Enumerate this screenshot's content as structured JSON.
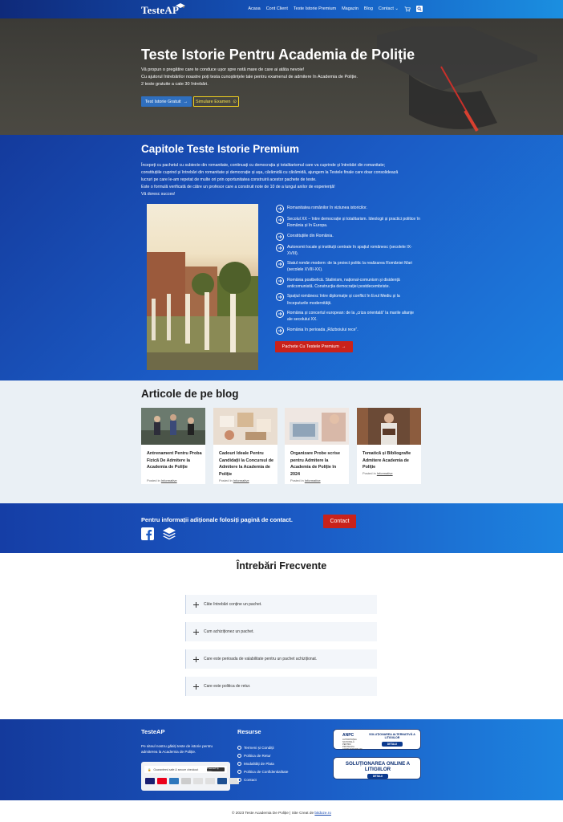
{
  "header": {
    "logo": "TesteAP",
    "nav": [
      "Acasa",
      "Cont Client",
      "Teste Istorie Premium",
      "Magazin",
      "Blog",
      "Contact ⌄"
    ]
  },
  "hero": {
    "title": "Teste Istorie Pentru Academia de Poliție",
    "lines": [
      "Vă propun o pregătire care te conduce ușor spre notă mare de care ai atâta nevoie!",
      "Cu ajutorul întrebărilor noastre poți testa cunoștințele tale pentru examenul de admitere în Academia de Poliție.",
      "2 teste gratuite a cate 30 întrebări."
    ],
    "btn_free": "Test Istorie Gratuit",
    "btn_sim": "Simulare Examen"
  },
  "chapters": {
    "title": "Capitole Teste Istorie Premium",
    "paragraph": [
      "Începeți cu pachetul cu subiecte din romanitate, continuați cu democrația și totalitarismul care va cuprinde și întrebări din romanitate;",
      "constituțiile cuprind și întrebări din romanitate și democrație și așa, cărămidă cu cărămidă, ajungem la Testele finale care doar consolidează",
      "lucruri pe care le-am repetat de multe ori prin oportunitatea construirii acestor pachete de teste.",
      "Este o formulă verificată de către un profesor care a construit note de 10 de a lungul anilor de experiență!",
      "Vă doresc succes!"
    ],
    "items": [
      "Romanitatea românilor în viziunea istoricilor.",
      "Secolul XX – între democrație și totalitarism. Ideologii și practici politice în România și în Europa.",
      "Constituțiile din România.",
      "Autonomii locale și instituții centrale în spațiul românesc (secolele IX-XVIII).",
      "Statul român modern: de la proiect politic la realizarea României Mari (secolele XVIII-XX).",
      "România postbelică. Stalinism, național-comunism și disidență anticomunistă. Construcția democrației postdecembriste.",
      "Spațiul românesc între diplomație și conflict în Evul Mediu și la începuturile modernității.",
      "România și concertul european: de la „criza orientală” la marile alianțe ale secolului XX.",
      "România în perioada „Războiului rece”."
    ],
    "btn": "Pachete Cu Testele Premium"
  },
  "blog": {
    "title": "Articole de pe blog",
    "posted_prefix": "Posted in",
    "category": "Informative",
    "cards": [
      {
        "title": "Antrenament Pentru Proba Fizică De Admitere la Academia de Poliție"
      },
      {
        "title": "Cadouri Ideale Pentru Candidații la Concursul de Admitere la Academia de Poliție"
      },
      {
        "title": "Organizare Probe scrise pentru Admitere la Academia de Poliție în 2024"
      },
      {
        "title": "Tematică și Bibliografie Admitere Academia de Poliție"
      }
    ]
  },
  "cta": {
    "text": "Pentru informații adiționale folosiți pagină de contact.",
    "btn": "Contact"
  },
  "faq": {
    "title": "Întrebări Frecvente",
    "items": [
      "Câte întrebări conține un pachet.",
      "Cum achiziționez un pachet.",
      "Care este perioada de valabilitate pentru un pachet achiziționat.",
      "Care este politica de retur."
    ]
  },
  "footer": {
    "brand": "TesteAP",
    "desc": [
      "Pe siteul nostru găsiți teste de istorie pentru",
      "admiterea la Academia de Poliție."
    ],
    "checkout": "Guaranteed safe & secure checkout",
    "powered": "Powered by stripe",
    "resources_title": "Resurse",
    "links": [
      "Termeni și Condiții",
      "Politica de Retur",
      "Modalități de Plata",
      "Politica de Confidentialitate",
      "Contact"
    ],
    "anpc1": {
      "logo": "ANPC",
      "sub": "AUTORITATEA NAȚIONALĂ PENTRU PROTECȚIA CONSUMATORILOR",
      "title": "SOLUȚIONAREA ALTERNATIVĂ A LITIGIILOR",
      "detalii": "DETALII"
    },
    "anpc2": {
      "title": "SOLUȚIONAREA ONLINE A LITIGIILOR",
      "detalii": "DETALII"
    }
  },
  "copyright": {
    "text": "© 2023 Teste Academia De Poliție | Site Creat de",
    "link": "bitdoze.ro"
  }
}
